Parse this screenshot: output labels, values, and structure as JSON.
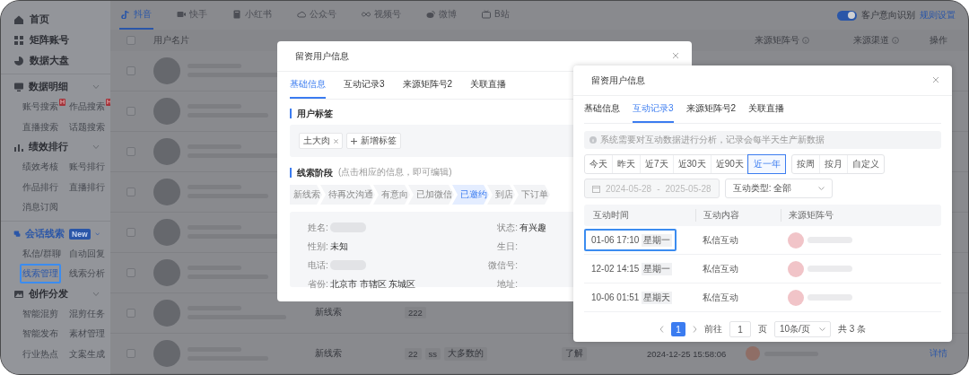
{
  "sidebar": {
    "sections": [
      {
        "items": [
          {
            "kind": "link",
            "label": "首页"
          },
          {
            "kind": "link",
            "label": "矩阵账号"
          },
          {
            "kind": "link",
            "label": "数据大盘"
          }
        ]
      },
      {
        "items": [
          {
            "kind": "group",
            "label": "数据明细",
            "expanded": true,
            "children": [
              {
                "label": "账号搜索",
                "badge": "H",
                "selected": false
              },
              {
                "label": "作品搜索",
                "badge": "H",
                "selected": false
              },
              {
                "label": "直播搜索",
                "selected": false
              },
              {
                "label": "话题搜索",
                "selected": false
              }
            ]
          },
          {
            "kind": "group",
            "label": "绩效排行",
            "expanded": true,
            "children": [
              {
                "label": "绩效考核",
                "selected": false
              },
              {
                "label": "账号排行",
                "selected": false
              },
              {
                "label": "作品排行",
                "selected": false
              },
              {
                "label": "直播排行",
                "selected": false
              },
              {
                "label": "消息订阅",
                "selected": false
              }
            ]
          }
        ]
      },
      {
        "items": [
          {
            "kind": "group",
            "label": "会话线索",
            "badge": "New",
            "expanded": true,
            "children": [
              {
                "label": "私信/群聊",
                "selected": false
              },
              {
                "label": "自动回复",
                "selected": false
              },
              {
                "label": "线索管理",
                "selected": true
              },
              {
                "label": "线索分析",
                "selected": false
              }
            ]
          },
          {
            "kind": "group",
            "label": "创作分发",
            "expanded": true,
            "children": [
              {
                "label": "智能混剪",
                "selected": false
              },
              {
                "label": "混剪任务",
                "selected": false
              },
              {
                "label": "智能发布",
                "selected": false
              },
              {
                "label": "素材管理",
                "selected": false
              },
              {
                "label": "行业热点",
                "selected": false
              },
              {
                "label": "文案生成",
                "selected": false
              }
            ]
          }
        ]
      }
    ]
  },
  "platform_tabs": [
    {
      "label": "抖音",
      "selected": true
    },
    {
      "label": "快手",
      "selected": false
    },
    {
      "label": "小红书",
      "selected": false
    },
    {
      "label": "公众号",
      "selected": false
    },
    {
      "label": "视频号",
      "selected": false
    },
    {
      "label": "微博",
      "selected": false
    },
    {
      "label": "B站",
      "selected": false
    }
  ],
  "intent_toggle": {
    "label": "客户意向识别",
    "on": true
  },
  "rules_link": "规则设置",
  "table": {
    "select_all_checked": false,
    "header": {
      "user_card": "用户名片",
      "source_account": "来源矩阵号",
      "source_channel": "来源渠道",
      "actions": "操作"
    },
    "rows": [
      {
        "checked": false
      },
      {
        "checked": false
      },
      {
        "checked": false
      },
      {
        "checked": false
      },
      {
        "checked": false
      },
      {
        "checked": false
      },
      {
        "checked": false,
        "stage": "新线索",
        "tags": [
          "222"
        ]
      },
      {
        "checked": false,
        "stage": "新线索",
        "tags": [
          "22",
          "ss",
          "大多数的"
        ],
        "intent": "了解",
        "time": "2024-12-25 15:58:06",
        "action": "详情"
      }
    ]
  },
  "lead_dialog": {
    "title": "留资用户信息",
    "tabs": [
      {
        "label": "基础信息",
        "selected": true
      },
      {
        "label": "互动记录3",
        "selected": false
      },
      {
        "label": "来源矩阵号2",
        "selected": false
      },
      {
        "label": "关联直播",
        "selected": false
      }
    ],
    "tags_title": "用户标签",
    "tags": [
      "土大肉"
    ],
    "add_tag": "新增标签",
    "stage_title": "线索阶段",
    "stage_hint": "(点击相应的信息，即可编辑)",
    "stages": [
      {
        "label": "新线索",
        "selected": false
      },
      {
        "label": "待再次沟通",
        "selected": false
      },
      {
        "label": "有意向",
        "selected": false
      },
      {
        "label": "已加微信",
        "selected": false
      },
      {
        "label": "已邀约",
        "selected": true
      },
      {
        "label": "到店",
        "selected": false
      },
      {
        "label": "下订单",
        "selected": false
      }
    ],
    "fields_left": [
      {
        "label": "姓名:",
        "kind": "masked"
      },
      {
        "label": "性别:",
        "kind": "text",
        "value": "未知"
      },
      {
        "label": "电话:",
        "kind": "masked"
      },
      {
        "label": "省份:",
        "kind": "text",
        "value": "北京市 市辖区 东城区"
      }
    ],
    "fields_right": [
      {
        "label": "状态:",
        "kind": "text",
        "value": "有兴趣"
      },
      {
        "label": "生日:",
        "kind": "empty"
      },
      {
        "label": "微信号:",
        "kind": "empty"
      },
      {
        "label": "地址:",
        "kind": "empty"
      }
    ]
  },
  "interaction_dialog": {
    "title": "留资用户信息",
    "tabs": [
      {
        "label": "基础信息",
        "selected": false
      },
      {
        "label": "互动记录3",
        "selected": true
      },
      {
        "label": "来源矩阵号2",
        "selected": false
      },
      {
        "label": "关联直播",
        "selected": false
      }
    ],
    "notice": "系统需要对互动数据进行分析，记录会每半天生产新数据",
    "quick_ranges": [
      {
        "label": "今天",
        "selected": false
      },
      {
        "label": "昨天",
        "selected": false
      },
      {
        "label": "近7天",
        "selected": false
      },
      {
        "label": "近30天",
        "selected": false
      },
      {
        "label": "近90天",
        "selected": false
      },
      {
        "label": "近一年",
        "selected": true
      }
    ],
    "periods": [
      {
        "label": "按周",
        "selected": false
      },
      {
        "label": "按月",
        "selected": false
      },
      {
        "label": "自定义",
        "selected": false
      }
    ],
    "date_start": "2024-05-28",
    "date_separator": "-",
    "date_end": "2025-05-28",
    "type_filter": "互动类型: 全部",
    "columns": [
      "互动时间",
      "互动内容",
      "来源矩阵号"
    ],
    "rows": [
      {
        "time": "01-06 17:10",
        "weekday": "星期一",
        "content": "私信互动",
        "highlighted": true
      },
      {
        "time": "12-02 14:15",
        "weekday": "星期一",
        "content": "私信互动",
        "highlighted": false
      },
      {
        "time": "10-06 01:51",
        "weekday": "星期天",
        "content": "私信互动",
        "highlighted": false
      }
    ],
    "pagination": {
      "pages": [
        {
          "label": "1",
          "selected": true
        }
      ],
      "goto_label": "前往",
      "goto_value": "1",
      "page_unit": "页",
      "page_size": "10条/页",
      "total": "共 3 条"
    }
  }
}
